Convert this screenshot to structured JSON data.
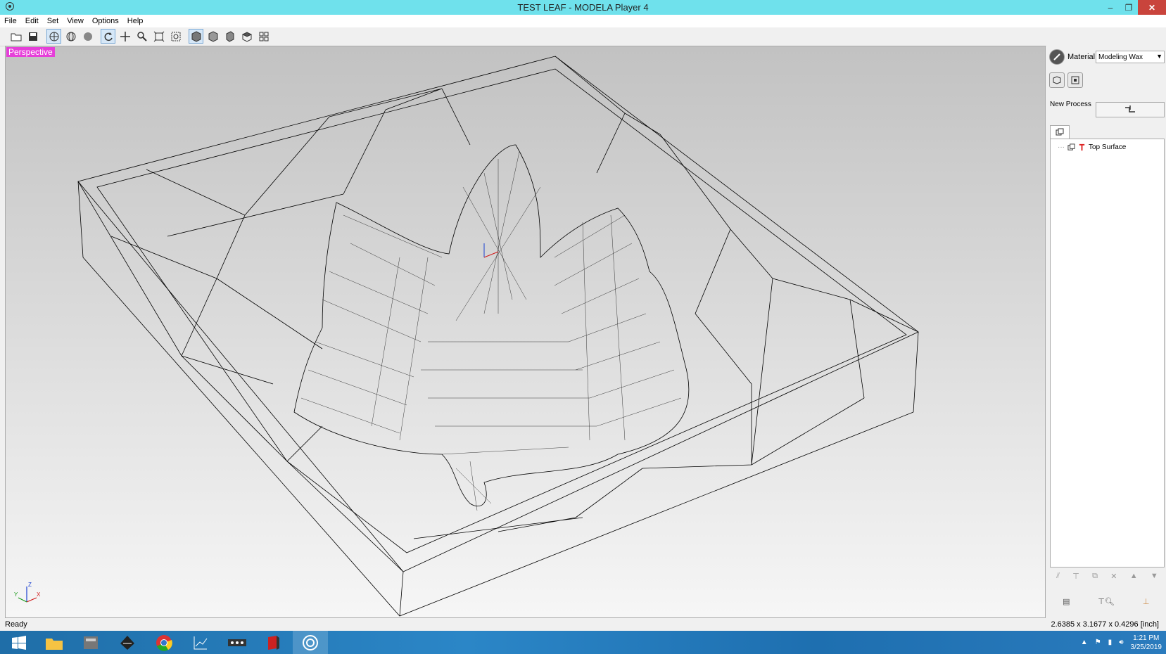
{
  "window": {
    "title": "TEST LEAF - MODELA Player 4",
    "minimize": "–",
    "restore": "❐",
    "close": "✕"
  },
  "menu": [
    "File",
    "Edit",
    "Set",
    "View",
    "Options",
    "Help"
  ],
  "toolbar": {
    "buttons": [
      "open-icon",
      "save-icon",
      "wireframe-icon",
      "globe-icon",
      "shaded-sphere-icon",
      "rotate-icon",
      "pan-icon",
      "zoom-icon",
      "fit-icon",
      "zoom-box-icon",
      "iso-view-icon",
      "front-view-icon",
      "side-view-icon",
      "top-view-icon",
      "multi-view-icon"
    ]
  },
  "viewport": {
    "label": "Perspective",
    "axes": {
      "z": "Z",
      "y": "Y",
      "x": "X"
    }
  },
  "right_panel": {
    "material_label": "Material",
    "material_value": "Modeling Wax",
    "new_process_label": "New Process",
    "tree_items": [
      {
        "label": "Top Surface"
      }
    ]
  },
  "status": {
    "left": "Ready",
    "right": "2.6385 x 3.1677 x 0.4296 [inch]"
  },
  "taskbar": {
    "time": "1:21 PM",
    "date": "3/25/2019"
  },
  "colors": {
    "titlebar": "#6fe1ec",
    "viewport_label": "#e63ed9",
    "close": "#c9443c",
    "taskbar": "#2b86c7"
  }
}
